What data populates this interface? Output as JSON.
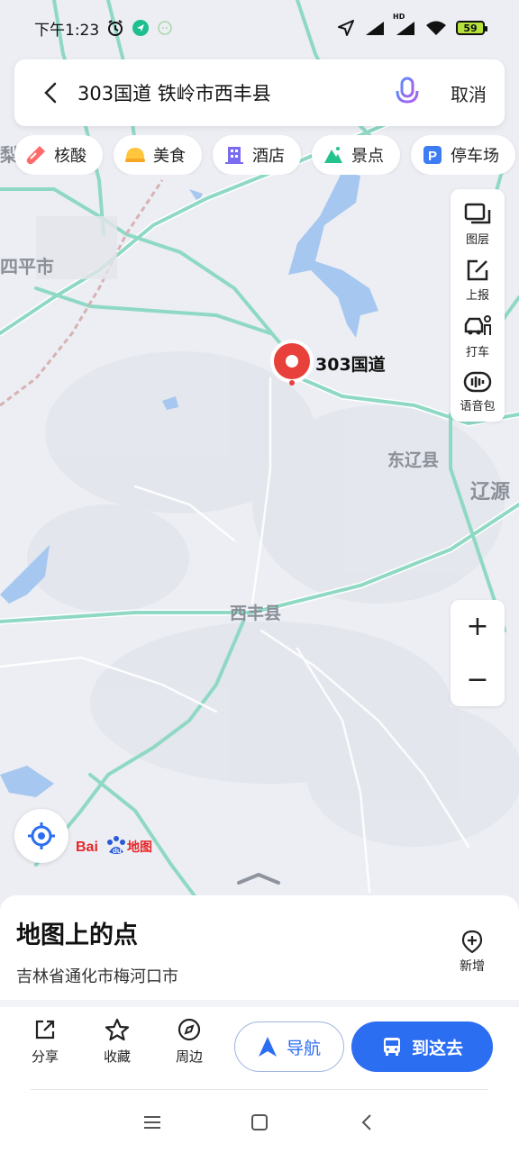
{
  "status_bar": {
    "time": "下午1:23",
    "battery": "59",
    "network": "HD"
  },
  "search": {
    "query": "303国道 铁岭市西丰县",
    "cancel_label": "取消"
  },
  "chips": [
    {
      "label": "核酸",
      "icon": "test-tube-icon"
    },
    {
      "label": "美食",
      "icon": "food-icon"
    },
    {
      "label": "酒店",
      "icon": "hotel-icon"
    },
    {
      "label": "景点",
      "icon": "scenic-icon"
    },
    {
      "label": "停车场",
      "icon": "parking-icon"
    }
  ],
  "tools": [
    {
      "label": "图层",
      "icon": "layers-icon"
    },
    {
      "label": "上报",
      "icon": "report-icon"
    },
    {
      "label": "打车",
      "icon": "taxi-icon"
    },
    {
      "label": "语音包",
      "icon": "voice-pack-icon"
    }
  ],
  "map": {
    "labels": {
      "siping": "四平市",
      "dongliao": "东辽县",
      "liaoyuan": "辽源",
      "xifeng": "西丰县",
      "li_partial": "梨"
    },
    "pin_label": "303国道",
    "logo": "Bai du 地图"
  },
  "zoom": {
    "plus": "+",
    "minus": "−"
  },
  "sheet": {
    "title": "地图上的点",
    "subtitle": "吉林省通化市梅河口市",
    "add_label": "新增",
    "actions": [
      {
        "label": "分享",
        "icon": "share-icon"
      },
      {
        "label": "收藏",
        "icon": "star-icon"
      },
      {
        "label": "周边",
        "icon": "compass-icon"
      }
    ],
    "nav_label": "导航",
    "go_label": "到这去"
  },
  "colors": {
    "accent": "#2c6ef2",
    "road": "#8fd9c4",
    "water": "#a6c7ef",
    "pin": "#e8403a"
  }
}
